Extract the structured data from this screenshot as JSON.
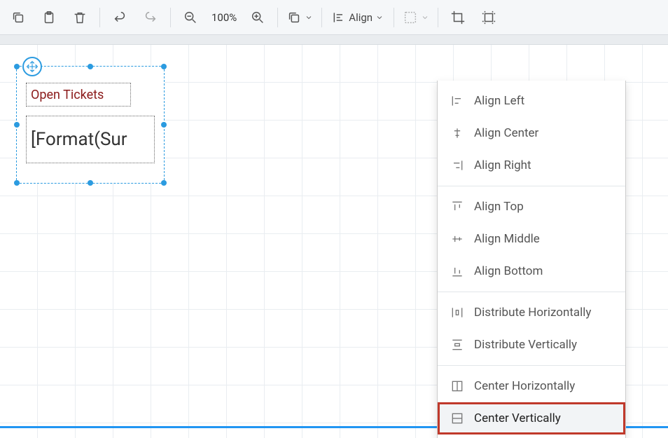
{
  "toolbar": {
    "zoom_level": "100%",
    "align_label": "Align"
  },
  "canvas": {
    "label_text": "Open Tickets",
    "data_text": "[Format(Sur"
  },
  "dropdown": {
    "items": [
      {
        "label": "Align Left",
        "icon": "align-left-icon"
      },
      {
        "label": "Align Center",
        "icon": "align-center-icon"
      },
      {
        "label": "Align Right",
        "icon": "align-right-icon"
      }
    ],
    "items2": [
      {
        "label": "Align Top",
        "icon": "align-top-icon"
      },
      {
        "label": "Align Middle",
        "icon": "align-middle-icon"
      },
      {
        "label": "Align Bottom",
        "icon": "align-bottom-icon"
      }
    ],
    "items3": [
      {
        "label": "Distribute Horizontally",
        "icon": "distribute-h-icon"
      },
      {
        "label": "Distribute Vertically",
        "icon": "distribute-v-icon"
      }
    ],
    "items4": [
      {
        "label": "Center Horizontally",
        "icon": "center-h-icon"
      },
      {
        "label": "Center Vertically",
        "icon": "center-v-icon"
      }
    ]
  }
}
